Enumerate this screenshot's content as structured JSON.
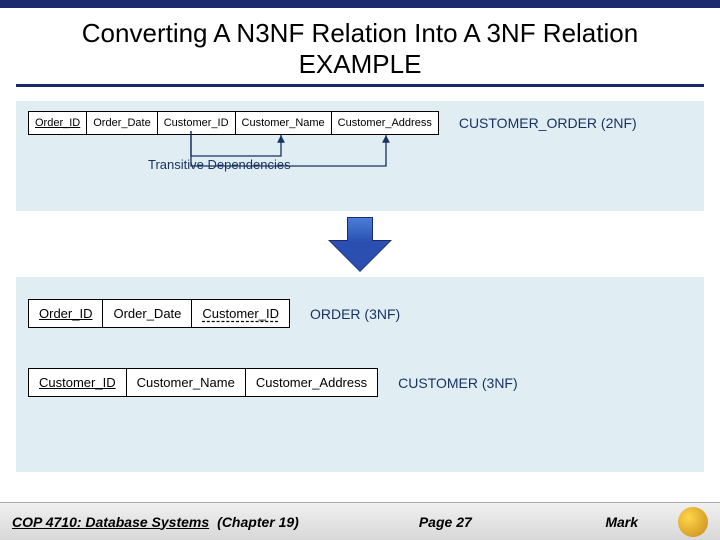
{
  "title": {
    "line1": "Converting A N3NF Relation Into A 3NF Relation",
    "line2": "EXAMPLE"
  },
  "top_relation": {
    "columns": [
      "Order_ID",
      "Order_Date",
      "Customer_ID",
      "Customer_Name",
      "Customer_Address"
    ],
    "name": "CUSTOMER_ORDER (2NF)"
  },
  "dependency_label": "Transitive Dependencies",
  "bottom_relations": {
    "order": {
      "columns": [
        "Order_ID",
        "Order_Date",
        "Customer_ID"
      ],
      "name": "ORDER (3NF)"
    },
    "customer": {
      "columns": [
        "Customer_ID",
        "Customer_Name",
        "Customer_Address"
      ],
      "name": "CUSTOMER (3NF)"
    }
  },
  "footer": {
    "course": "COP 4710: Database Systems",
    "chapter": "(Chapter 19)",
    "page": "Page 27",
    "author": "Mark"
  }
}
